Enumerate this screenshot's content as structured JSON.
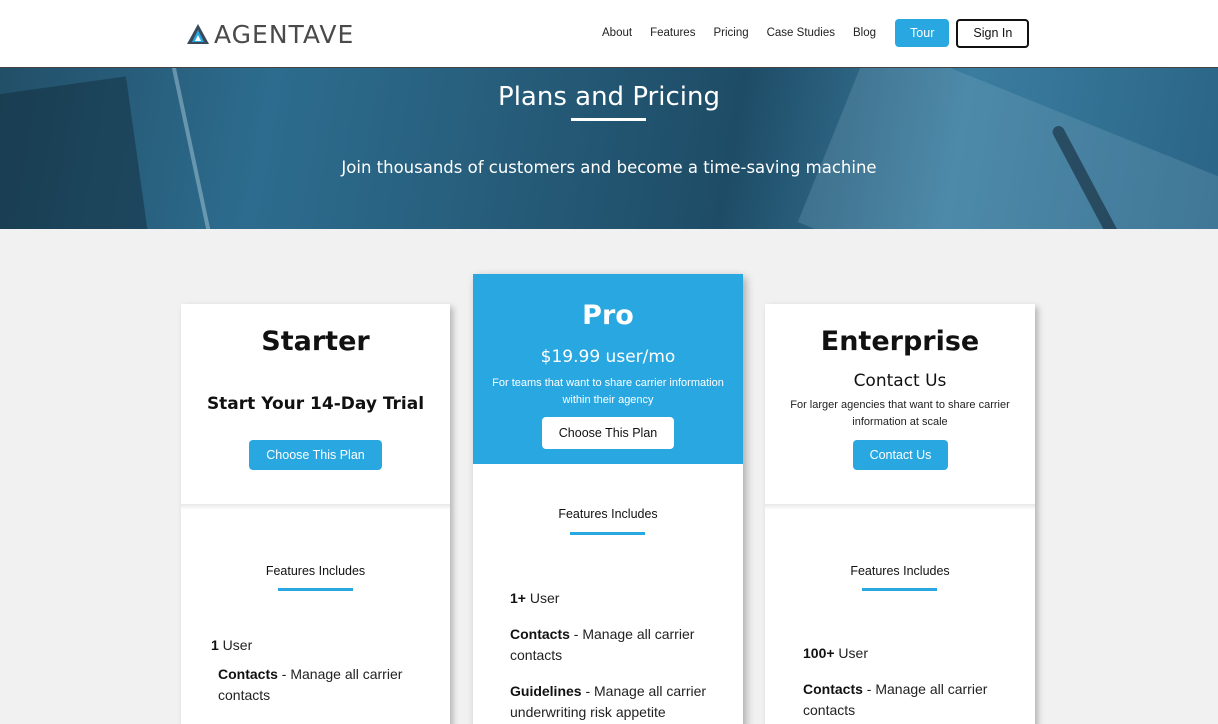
{
  "header": {
    "brand": "AGENTAVE",
    "nav": [
      "About",
      "Features",
      "Pricing",
      "Case Studies",
      "Blog"
    ],
    "tour_label": "Tour",
    "signin_label": "Sign In"
  },
  "hero": {
    "title": "Plans and Pricing",
    "subtitle": "Join thousands of customers and become a time-saving machine"
  },
  "plans": {
    "starter": {
      "name": "Starter",
      "price": "Start Your 14-Day Trial",
      "button": "Choose This Plan",
      "features_title": "Features Includes",
      "features": [
        {
          "bold": "1",
          "text": " User"
        },
        {
          "bold": "Contacts",
          "text": " - Manage all carrier contacts"
        }
      ]
    },
    "pro": {
      "name": "Pro",
      "price": "$19.99 user/mo",
      "description": "For teams that want to share carrier information within their agency",
      "button": "Choose This Plan",
      "features_title": "Features Includes",
      "features": [
        {
          "bold": "1+",
          "text": " User"
        },
        {
          "bold": "Contacts",
          "text": " - Manage all carrier contacts"
        },
        {
          "bold": "Guidelines",
          "text": " - Manage all carrier underwriting risk appetite"
        }
      ]
    },
    "enterprise": {
      "name": "Enterprise",
      "price": "Contact Us",
      "description": "For larger agencies that want to share carrier information at scale",
      "button": "Contact Us",
      "features_title": "Features Includes",
      "features": [
        {
          "bold": "100+",
          "text": " User"
        },
        {
          "bold": "Contacts",
          "text": " - Manage all carrier contacts"
        }
      ]
    }
  },
  "colors": {
    "accent": "#29a7e1",
    "hero_tint": "#2d6c8e"
  }
}
